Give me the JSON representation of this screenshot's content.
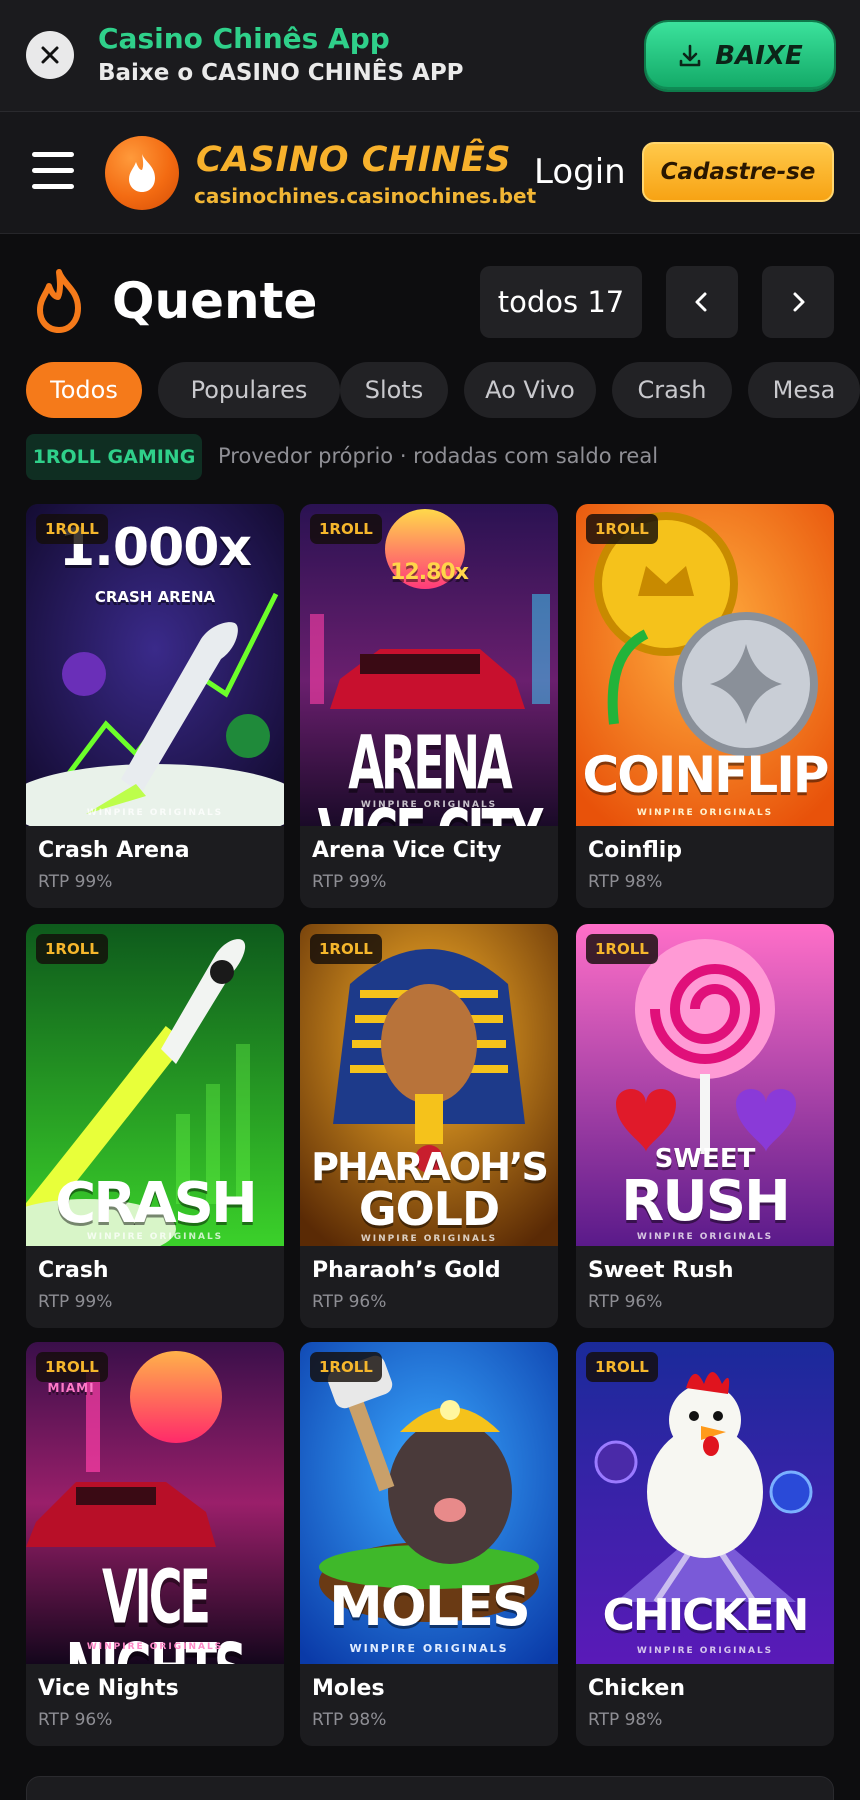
{
  "app_banner": {
    "title": "Casino Chinês App",
    "subtitle": "Baixe o CASINO CHINÊS APP",
    "download_label": "BAIXE"
  },
  "header": {
    "brand_name": "CASINO CHINÊS",
    "brand_domain": "casinochines.casinochines.bet",
    "login_label": "Login",
    "signup_label": "Cadastre-se"
  },
  "section": {
    "title": "Quente",
    "count_label": "todos 17"
  },
  "categories": [
    {
      "label": "Todos",
      "active": true
    },
    {
      "label": "Populares",
      "active": false
    },
    {
      "label": "Slots",
      "active": false
    },
    {
      "label": "Ao Vivo",
      "active": false
    },
    {
      "label": "Crash",
      "active": false
    },
    {
      "label": "Mesa",
      "active": false
    }
  ],
  "provider": {
    "badge": "1ROLL GAMING",
    "description": "Provedor próprio · rodadas com saldo real"
  },
  "games": [
    {
      "tag": "1ROLL",
      "name": "Crash Arena",
      "rtp": "RTP 99%",
      "art_title": "1.000x",
      "art_sub": "CRASH ARENA",
      "art_footer": "WINPIRE ORIGINALS"
    },
    {
      "tag": "1ROLL",
      "name": "Arena Vice City",
      "rtp": "RTP 99%",
      "art_title": "ARENA VICE CITY",
      "art_sub": "12.80x",
      "art_footer": "WINPIRE ORIGINALS"
    },
    {
      "tag": "1ROLL",
      "name": "Coinflip",
      "rtp": "RTP 98%",
      "art_title": "COINFLIP",
      "art_sub": "",
      "art_footer": "WINPIRE ORIGINALS"
    },
    {
      "tag": "1ROLL",
      "name": "Crash",
      "rtp": "RTP 99%",
      "art_title": "CRASH",
      "art_sub": "",
      "art_footer": "WINPIRE ORIGINALS"
    },
    {
      "tag": "1ROLL",
      "name": "Pharaoh’s Gold",
      "rtp": "RTP 96%",
      "art_title": "PHARAOH’S",
      "art_sub": "GOLD",
      "art_footer": "WINPIRE ORIGINALS"
    },
    {
      "tag": "1ROLL",
      "name": "Sweet Rush",
      "rtp": "RTP 96%",
      "art_title": "RUSH",
      "art_sub": "SWEET",
      "art_footer": "WINPIRE ORIGINALS"
    },
    {
      "tag": "1ROLL",
      "name": "Vice Nights",
      "rtp": "RTP 96%",
      "art_title": "VICE NIGHTS",
      "art_sub": "MIAMI",
      "art_footer": "WINPIRE ORIGINALS"
    },
    {
      "tag": "1ROLL",
      "name": "Moles",
      "rtp": "RTP 98%",
      "art_title": "MOLES",
      "art_sub": "",
      "art_footer": "WINPIRE ORIGINALS"
    },
    {
      "tag": "1ROLL",
      "name": "Chicken",
      "rtp": "RTP 98%",
      "art_title": "CHICKEN",
      "art_sub": "",
      "art_footer": "WINPIRE ORIGINALS"
    }
  ],
  "colors": {
    "accent_orange": "#f57a1a",
    "brand_gold": "#f7b12c",
    "app_green": "#2fd08a",
    "background": "#0d0d0f"
  }
}
